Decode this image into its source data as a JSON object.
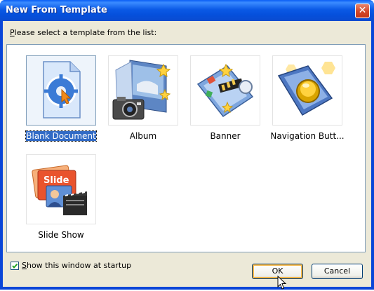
{
  "window": {
    "title": "New From Template",
    "close_symbol": "✕"
  },
  "prompt": {
    "hotkey": "P",
    "rest": "lease select a template from the list:"
  },
  "templates": [
    {
      "label": "Blank Document",
      "icon": "blank-document-icon",
      "selected": true
    },
    {
      "label": "Album",
      "icon": "album-icon",
      "selected": false
    },
    {
      "label": "Banner",
      "icon": "banner-icon",
      "selected": false
    },
    {
      "label": "Navigation Butt...",
      "icon": "navigation-button-icon",
      "selected": false
    },
    {
      "label": "Slide Show",
      "icon": "slide-show-icon",
      "selected": false
    }
  ],
  "startup": {
    "hotkey": "S",
    "rest": "how this window at startup",
    "checked": true
  },
  "buttons": {
    "ok": "OK",
    "cancel": "Cancel"
  },
  "colors": {
    "titlebar": "#0a5ef6",
    "selection": "#316ac5",
    "dialog_bg": "#ece9d8"
  }
}
